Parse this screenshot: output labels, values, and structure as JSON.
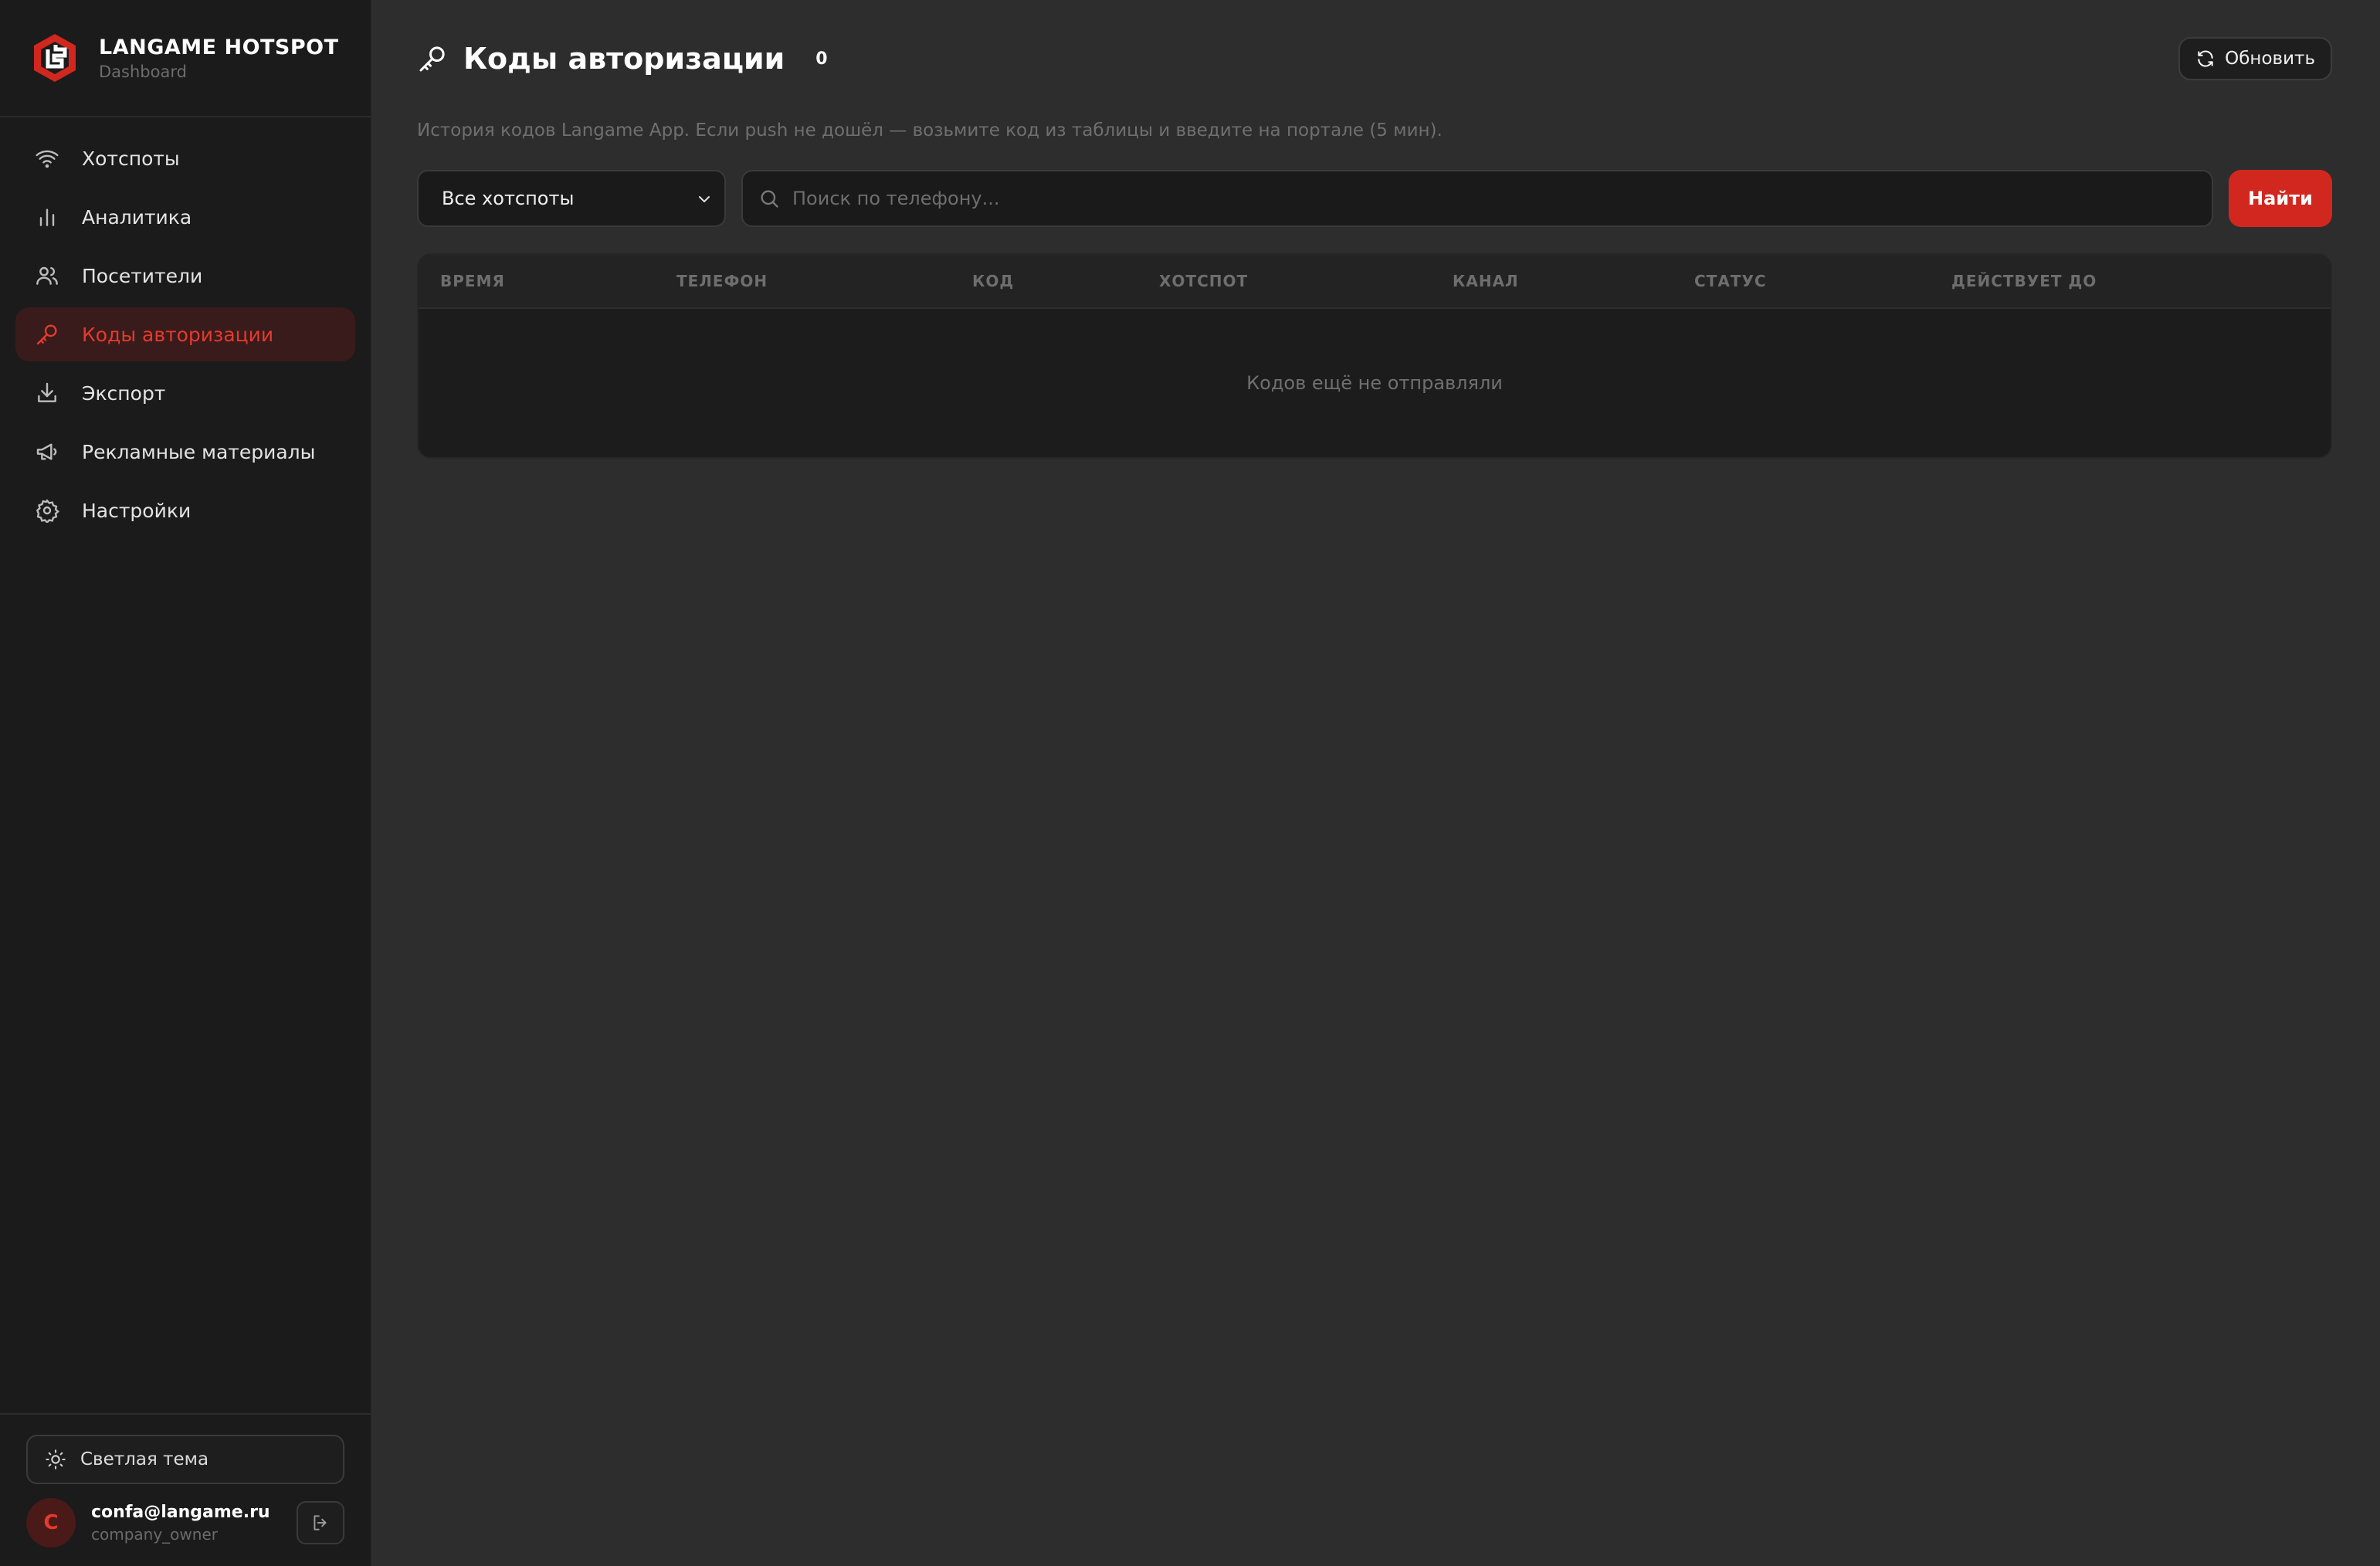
{
  "brand": {
    "title": "LANGAME HOTSPOT",
    "subtitle": "Dashboard"
  },
  "sidebar": {
    "items": [
      {
        "label": "Хотспоты",
        "icon": "wifi-icon",
        "active": false
      },
      {
        "label": "Аналитика",
        "icon": "bar-chart-icon",
        "active": false
      },
      {
        "label": "Посетители",
        "icon": "users-icon",
        "active": false
      },
      {
        "label": "Коды авторизации",
        "icon": "key-icon",
        "active": true
      },
      {
        "label": "Экспорт",
        "icon": "download-icon",
        "active": false
      },
      {
        "label": "Рекламные материалы",
        "icon": "megaphone-icon",
        "active": false
      },
      {
        "label": "Настройки",
        "icon": "gear-icon",
        "active": false
      }
    ],
    "theme_toggle_label": "Светлая тема",
    "user": {
      "avatar_letter": "C",
      "email": "confa@langame.ru",
      "role": "company_owner"
    }
  },
  "header": {
    "title": "Коды авторизации",
    "count": "0",
    "refresh_label": "Обновить"
  },
  "subtitle": "История кодов Langame App. Если push не дошёл — возьмите код из таблицы и введите на портале (5 мин).",
  "filters": {
    "hotspot_select": "Все хотспоты",
    "search_placeholder": "Поиск по телефону...",
    "search_button": "Найти"
  },
  "table": {
    "columns": [
      "ВРЕМЯ",
      "ТЕЛЕФОН",
      "КОД",
      "ХОТСПОТ",
      "КАНАЛ",
      "СТАТУС",
      "ДЕЙСТВУЕТ ДО"
    ],
    "empty_text": "Кодов ещё не отправляли"
  },
  "colors": {
    "accent": "#d2271f",
    "active_text": "#e53a2d",
    "sidebar_bg": "#1b1b1b",
    "main_bg": "#2d2d2d"
  }
}
